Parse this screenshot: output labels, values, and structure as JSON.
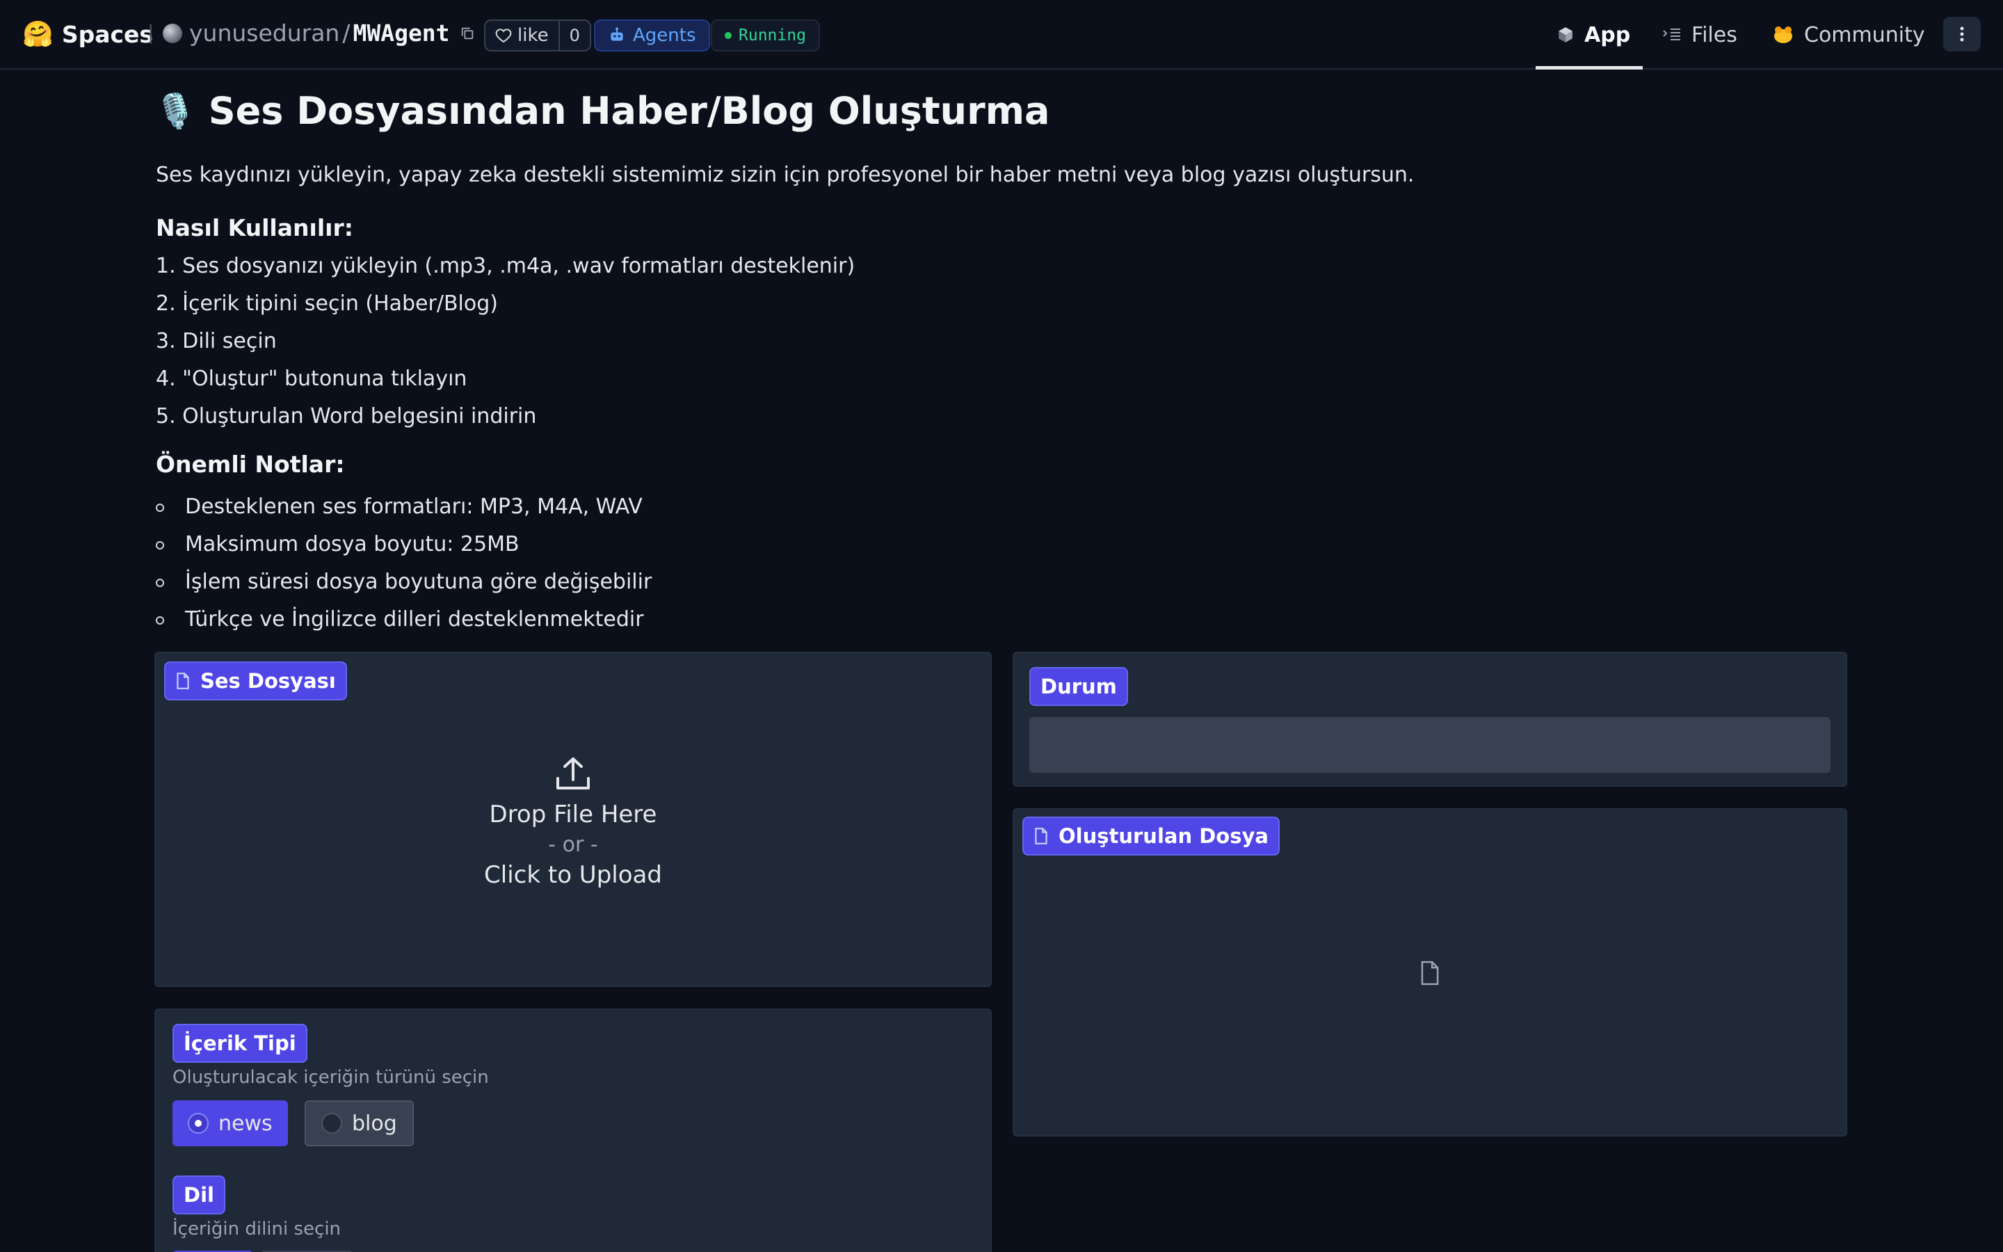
{
  "topbar": {
    "logo_emoji": "🤗",
    "spaces_label": "Spaces",
    "owner": "yunuseduran",
    "repo": "MWAgent",
    "like_label": "like",
    "like_count": "0",
    "agents_label": "Agents",
    "status_label": "Running",
    "tabs": [
      {
        "label": "App",
        "icon": "cube-icon",
        "active": true
      },
      {
        "label": "Files",
        "icon": "files-icon",
        "active": false
      },
      {
        "label": "Community",
        "icon": "community-icon",
        "active": false
      }
    ]
  },
  "page": {
    "title_emoji": "🎙️",
    "title": "Ses Dosyasından Haber/Blog Oluşturma",
    "intro": "Ses kaydınızı yükleyin, yapay zeka destekli sistemimiz sizin için profesyonel bir haber metni veya blog yazısı oluştursun.",
    "howto_heading": "Nasıl Kullanılır:",
    "steps": [
      "1. Ses dosyanızı yükleyin (.mp3, .m4a, .wav formatları desteklenir)",
      "2. İçerik tipini seçin (Haber/Blog)",
      "3. Dili seçin",
      "4. \"Oluştur\" butonuna tıklayın",
      "5. Oluşturulan Word belgesini indirin"
    ],
    "notes_heading": "Önemli Notlar:",
    "notes": [
      "Desteklenen ses formatları: MP3, M4A, WAV",
      "Maksimum dosya boyutu: 25MB",
      "İşlem süresi dosya boyutuna göre değişebilir",
      "Türkçe ve İngilizce dilleri desteklenmektedir"
    ]
  },
  "audio_input": {
    "label": "Ses Dosyası",
    "drop_text": "Drop File Here",
    "or_text": "- or -",
    "click_text": "Click to Upload"
  },
  "status": {
    "label": "Durum",
    "value": ""
  },
  "output_file": {
    "label": "Oluşturulan Dosya"
  },
  "content_type": {
    "label": "İçerik Tipi",
    "info": "Oluşturulacak içeriğin türünü seçin",
    "options": [
      "news",
      "blog"
    ],
    "selected": "news"
  },
  "language": {
    "label": "Dil",
    "info": "İçeriğin dilini seçin"
  },
  "colors": {
    "background": "#0b0f19",
    "panel": "#1f2937",
    "accent": "#4f46e5",
    "running": "#34d399",
    "agents": "#60a5fa"
  }
}
